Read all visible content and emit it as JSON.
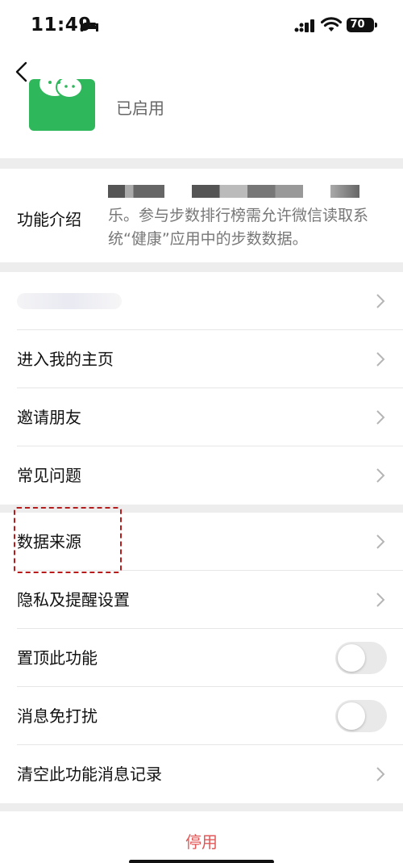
{
  "status_bar": {
    "time": "11:49",
    "battery": "70"
  },
  "header": {
    "app_status": "已启用"
  },
  "intro": {
    "label": "功能介绍",
    "description": "乐。参与步数排行榜需允许微信读取系统“健康”应用中的步数数据。"
  },
  "list": {
    "items": [
      {
        "label": "",
        "type": "chevron"
      },
      {
        "label": "进入我的主页",
        "type": "chevron"
      },
      {
        "label": "邀请朋友",
        "type": "chevron"
      },
      {
        "label": "常见问题",
        "type": "chevron"
      },
      {
        "label": "数据来源",
        "type": "chevron"
      },
      {
        "label": "隐私及提醒设置",
        "type": "chevron"
      },
      {
        "label": "置顶此功能",
        "type": "toggle",
        "on": false
      },
      {
        "label": "消息免打扰",
        "type": "toggle",
        "on": false
      },
      {
        "label": "清空此功能消息记录",
        "type": "chevron"
      }
    ]
  },
  "bottom": {
    "stop_label": "停用"
  },
  "colors": {
    "accent_green": "#2eb75b",
    "danger_red": "#e15858",
    "background": "#ededed"
  }
}
